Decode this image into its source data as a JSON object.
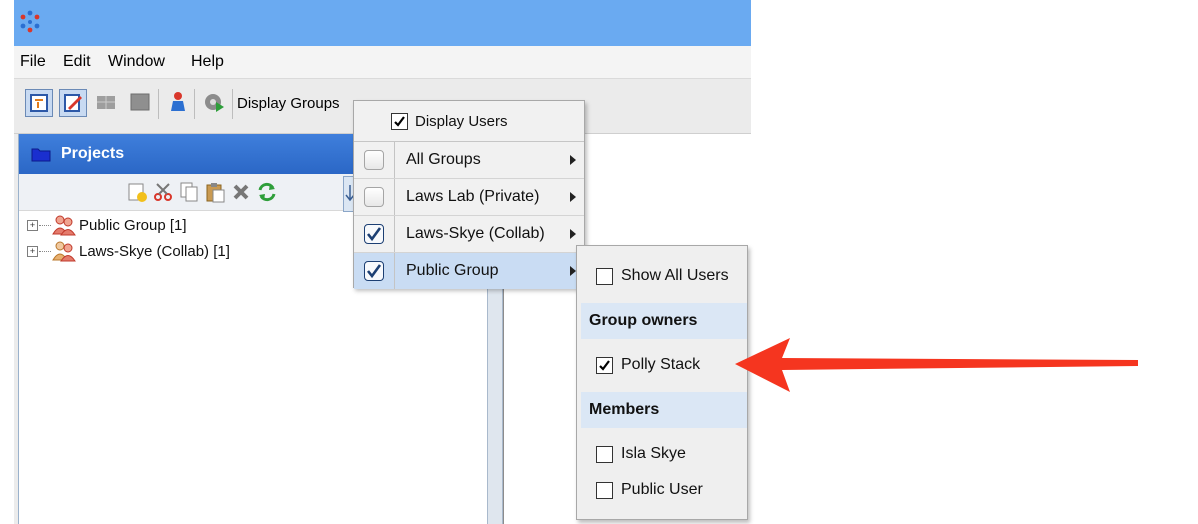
{
  "app": {
    "menus": [
      "File",
      "Edit",
      "Window",
      "Help"
    ]
  },
  "toolbar": {
    "display_groups_label": "Display Groups"
  },
  "projects_panel": {
    "title": "Projects",
    "tree": [
      {
        "label": "Public Group [1]"
      },
      {
        "label": "Laws-Skye (Collab) [1]"
      }
    ]
  },
  "groups_menu": {
    "display_users": {
      "label": "Display Users",
      "checked": true
    },
    "items": [
      {
        "label": "All Groups",
        "checked": false
      },
      {
        "label": "Laws Lab (Private)",
        "checked": false
      },
      {
        "label": "Laws-Skye (Collab)",
        "checked": true
      },
      {
        "label": "Public Group",
        "checked": true,
        "highlighted": true
      }
    ]
  },
  "users_submenu": {
    "show_all_users": {
      "label": "Show All Users",
      "checked": false
    },
    "owners_heading": "Group owners",
    "owners": [
      {
        "label": "Polly Stack",
        "checked": true
      }
    ],
    "members_heading": "Members",
    "members": [
      {
        "label": "Isla Skye",
        "checked": false
      },
      {
        "label": "Public User",
        "checked": false
      }
    ]
  },
  "colors": {
    "titlebar": "#6aaaf1",
    "panel_header": "#3573d3",
    "highlight": "#c9dcf3",
    "annotation_arrow": "#f5351f"
  }
}
